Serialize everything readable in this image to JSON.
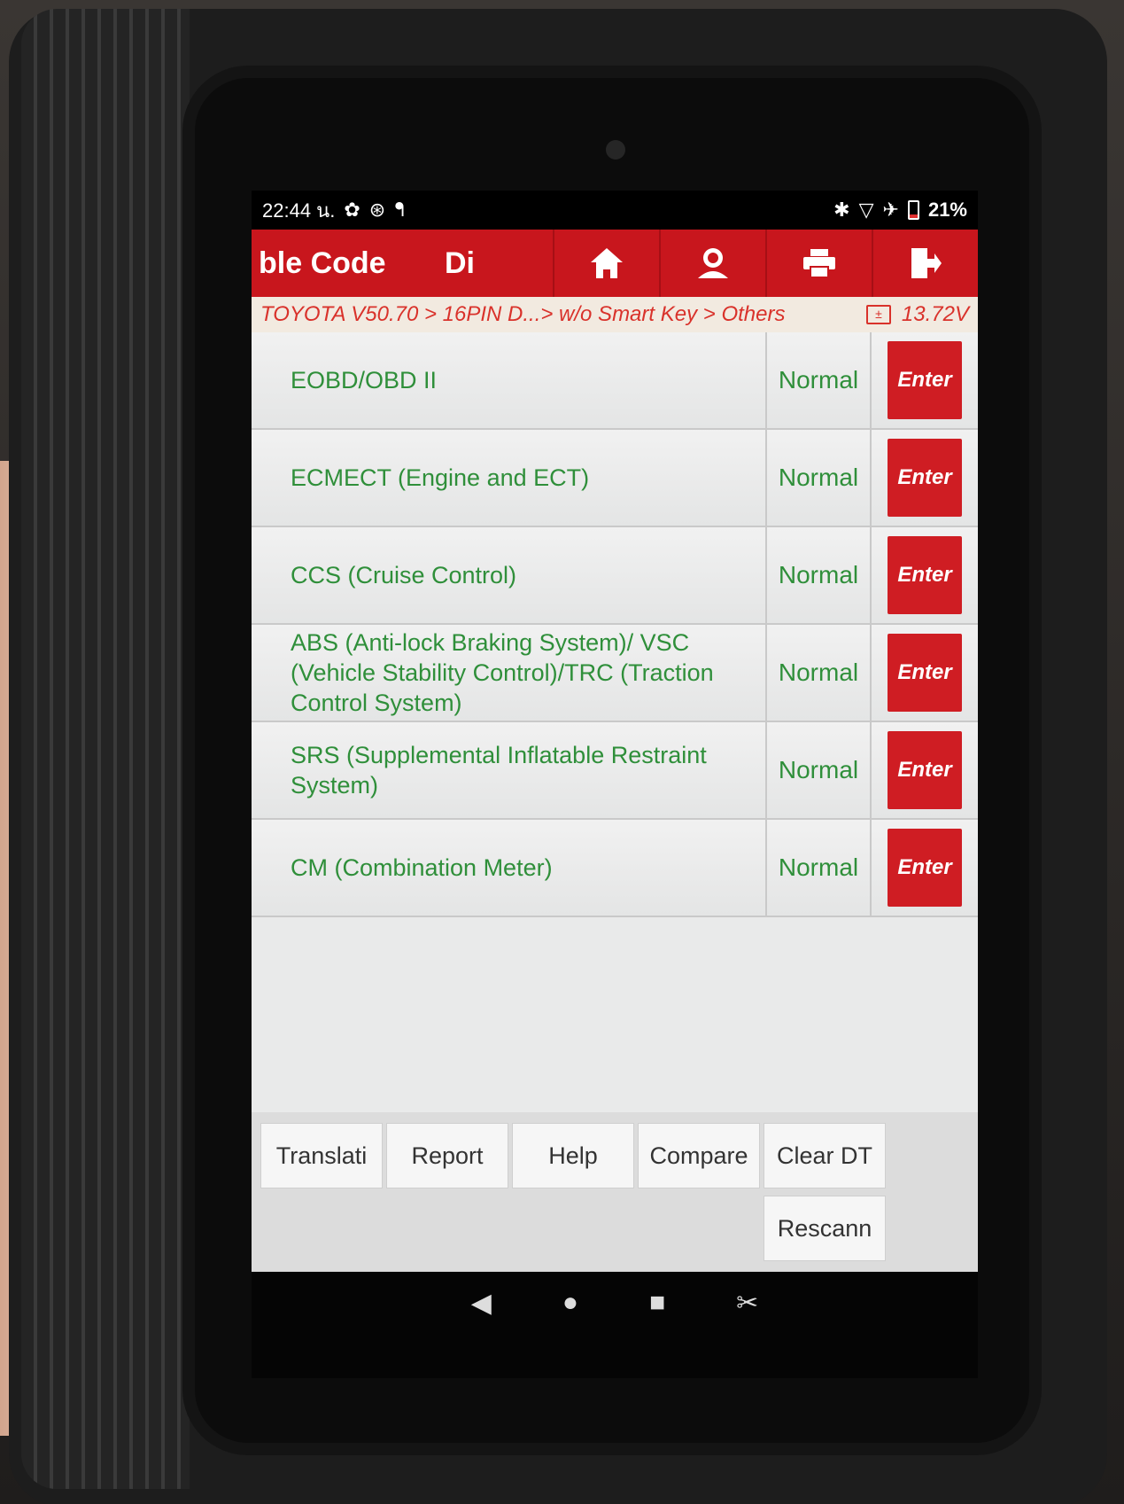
{
  "status_bar": {
    "time": "22:44 น.",
    "battery": "21%",
    "battery_level": 0.21
  },
  "header": {
    "title": "ble Code",
    "title2": "Di",
    "icons": [
      "home-icon",
      "user-icon",
      "printer-icon",
      "exit-icon"
    ]
  },
  "breadcrumb": {
    "path": "TOYOTA V50.70 > 16PIN D...> w/o Smart Key > Others",
    "voltage": "13.72V"
  },
  "systems": [
    {
      "name": "EOBD/OBD II",
      "status": "Normal",
      "action": "Enter"
    },
    {
      "name": "ECMECT (Engine and ECT)",
      "status": "Normal",
      "action": "Enter"
    },
    {
      "name": "CCS (Cruise Control)",
      "status": "Normal",
      "action": "Enter"
    },
    {
      "name": "ABS (Anti-lock Braking System)/ VSC (Vehicle Stability Control)/TRC (Traction Control System)",
      "status": "Normal",
      "action": "Enter"
    },
    {
      "name": "SRS (Supplemental Inflatable Restraint System)",
      "status": "Normal",
      "action": "Enter"
    },
    {
      "name": "CM (Combination Meter)",
      "status": "Normal",
      "action": "Enter"
    }
  ],
  "toolbar": {
    "translation": "Translati",
    "report": "Report",
    "help": "Help",
    "compare": "Compare",
    "clear_dtc": "Clear DT",
    "rescan": "Rescann"
  },
  "colors": {
    "header_red": "#c8161d",
    "text_green": "#2f8f3a",
    "breadcrumb_red": "#d9322b"
  }
}
